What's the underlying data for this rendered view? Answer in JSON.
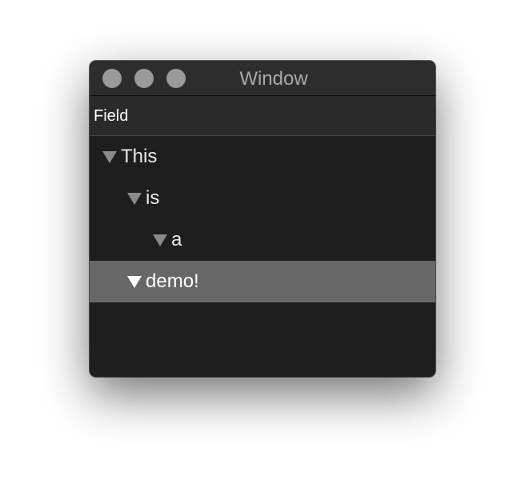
{
  "window": {
    "title": "Window"
  },
  "header": {
    "column_label": "Field"
  },
  "tree": {
    "rows": [
      {
        "label": "This",
        "expanded": true,
        "depth": 0
      },
      {
        "label": "is",
        "expanded": true,
        "depth": 1
      },
      {
        "label": "a",
        "expanded": true,
        "depth": 2
      },
      {
        "label": "demo!",
        "expanded": true,
        "depth": 1,
        "selected": true
      }
    ]
  },
  "icons": {
    "disclosure": "disclosure-triangle-down-icon"
  },
  "colors": {
    "window_bg": "#1e1e1e",
    "titlebar_bg": "#2d2d2d",
    "selection_bg": "#676767",
    "traffic_light": "#9a9a9a"
  }
}
